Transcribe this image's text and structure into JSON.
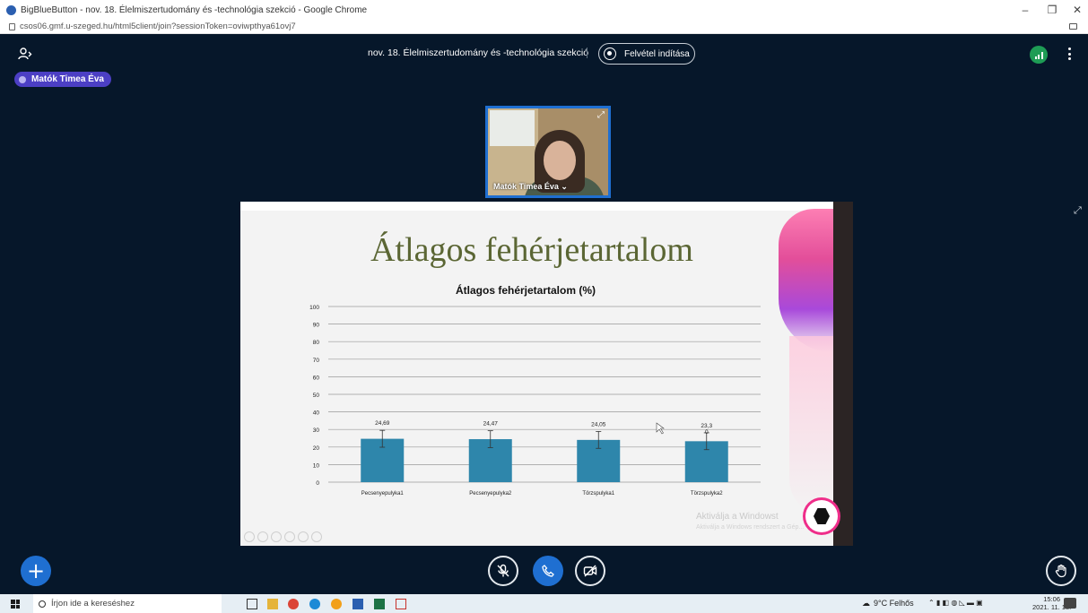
{
  "browser": {
    "window_title": "BigBlueButton - nov. 18. Élelmiszertudomány és -technológia szekció - Google Chrome",
    "url": "csos06.gmf.u-szeged.hu/html5client/join?sessionToken=oviwpthya61ovj7",
    "controls": [
      "–",
      "❐",
      "✕"
    ]
  },
  "header": {
    "meeting_title": "nov. 18. Élelmiszertudomány és -technológia szekció",
    "record_label": "Felvétel indítása",
    "icons": [
      "user-list-icon",
      "connection-status-icon",
      "more-options-icon"
    ]
  },
  "talker": {
    "name": "Matók Timea Éva"
  },
  "webcam": {
    "name": "Matók Timea Éva ⌄"
  },
  "slide": {
    "title": "Átlagos fehérjetartalom",
    "watermark_line1": "Aktiválja a Windowst",
    "watermark_line2": "Aktiválja a Windows rendszert a Gép..."
  },
  "chart_data": {
    "type": "bar",
    "title": "Átlagos fehérjetartalom (%)",
    "categories": [
      "Pecsenyepulyka1",
      "Pecsenyepulyka2",
      "Törzspulyka1",
      "Törzspulyka2"
    ],
    "values": [
      24.69,
      24.47,
      24.05,
      23.3
    ],
    "value_labels": [
      "24,69",
      "24,47",
      "24,05",
      "23,3"
    ],
    "extra_label": "0",
    "error": [
      4.8,
      4.8,
      4.8,
      4.8
    ],
    "ylim": [
      0,
      100
    ],
    "yticks": [
      0,
      10,
      20,
      30,
      40,
      50,
      60,
      70,
      80,
      90,
      100
    ],
    "grid": true,
    "bar_color": "#2e86ab"
  },
  "actions": {
    "icons": [
      "add-icon",
      "mute-microphone-icon",
      "leave-audio-icon",
      "share-webcam-icon",
      "raise-hand-icon"
    ]
  },
  "taskbar": {
    "search_placeholder": "Írjon ide a kereséshez",
    "weather": "9°C Felhős",
    "time": "15:06",
    "date": "2021. 11. 18."
  }
}
